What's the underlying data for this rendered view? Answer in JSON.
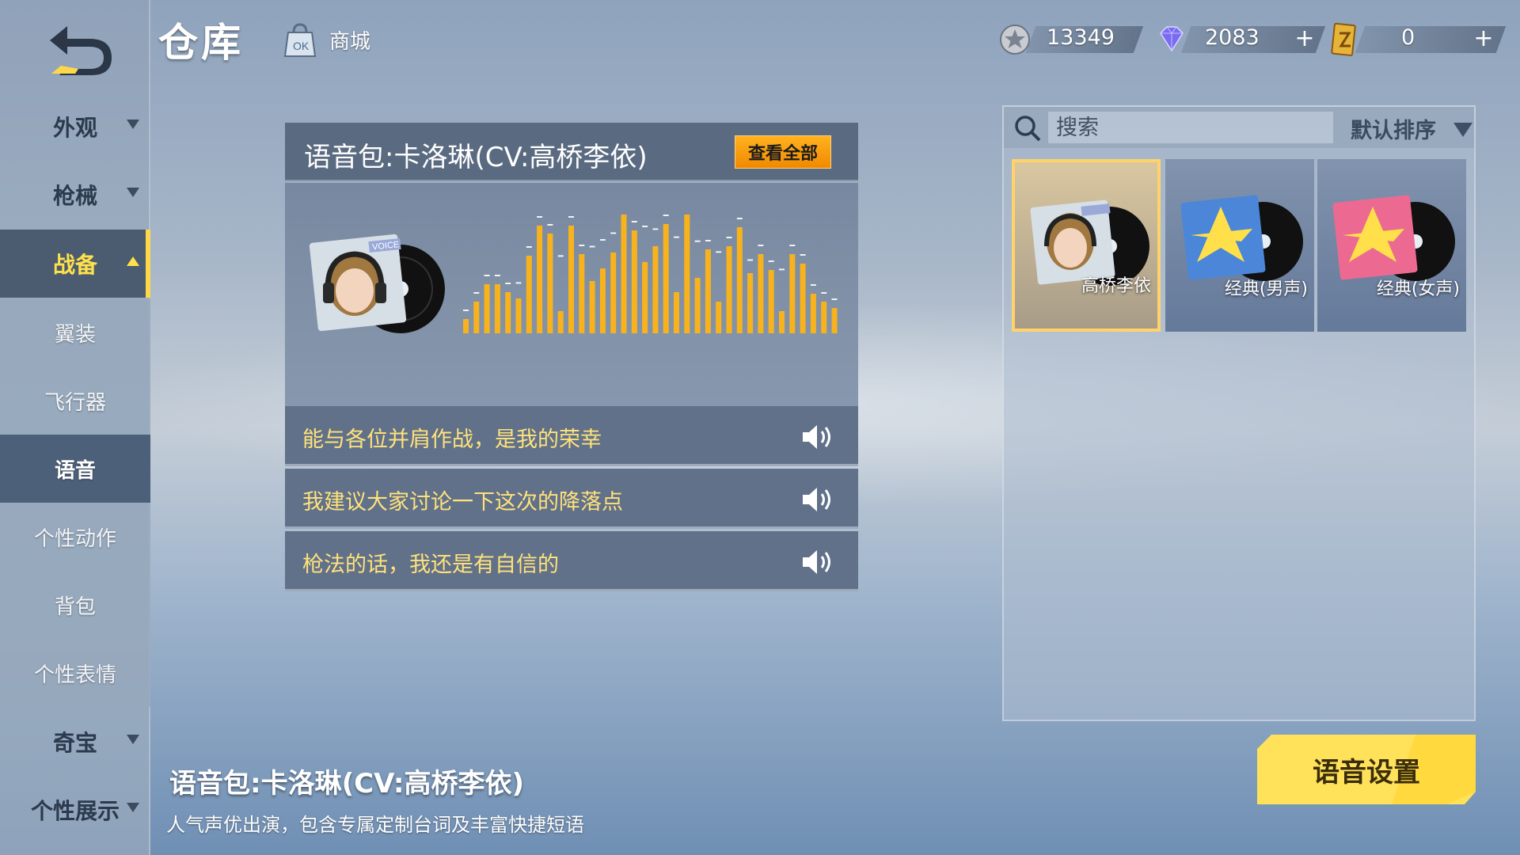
{
  "header": {
    "title": "仓库",
    "shop_label": "商城",
    "currencies": [
      {
        "icon": "silver-coin-icon",
        "value": "13349",
        "has_plus": false
      },
      {
        "icon": "diamond-icon",
        "value": "2083",
        "has_plus": true
      },
      {
        "icon": "ticket-icon",
        "value": "0",
        "has_plus": true
      }
    ]
  },
  "sidebar": {
    "items": [
      {
        "label": "外观",
        "expandable": true
      },
      {
        "label": "枪械",
        "expandable": true
      },
      {
        "label": "战备",
        "expandable": true,
        "active": true
      },
      {
        "label": "奇宝",
        "expandable": true
      },
      {
        "label": "个性展示",
        "expandable": true
      }
    ],
    "sub_items": [
      {
        "label": "翼装"
      },
      {
        "label": "飞行器"
      },
      {
        "label": "语音",
        "active": true
      },
      {
        "label": "个性动作"
      },
      {
        "label": "背包"
      },
      {
        "label": "个性表情"
      }
    ]
  },
  "panel": {
    "title": "语音包:卡洛琳(CV:高桥李依)",
    "view_all": "查看全部",
    "lines": [
      "能与各位并肩作战，是我的荣幸",
      "我建议大家讨论一下这次的降落点",
      "枪法的话，我还是有自信的"
    ]
  },
  "right_panel": {
    "search_placeholder": "搜索",
    "sort_label": "默认排序",
    "cards": [
      {
        "label": "高桥李依",
        "selected": true
      },
      {
        "label": "经典(男声)",
        "selected": false
      },
      {
        "label": "经典(女声)",
        "selected": false
      }
    ]
  },
  "footer": {
    "title": "语音包:卡洛琳(CV:高桥李依)",
    "description": "人气声优出演，包含专属定制台词及丰富快捷短语",
    "voice_settings": "语音设置"
  },
  "colors": {
    "accent_yellow": "#ffd84a",
    "orange_button": "#f39a0b",
    "sidebar_active": "#4b5b70"
  }
}
